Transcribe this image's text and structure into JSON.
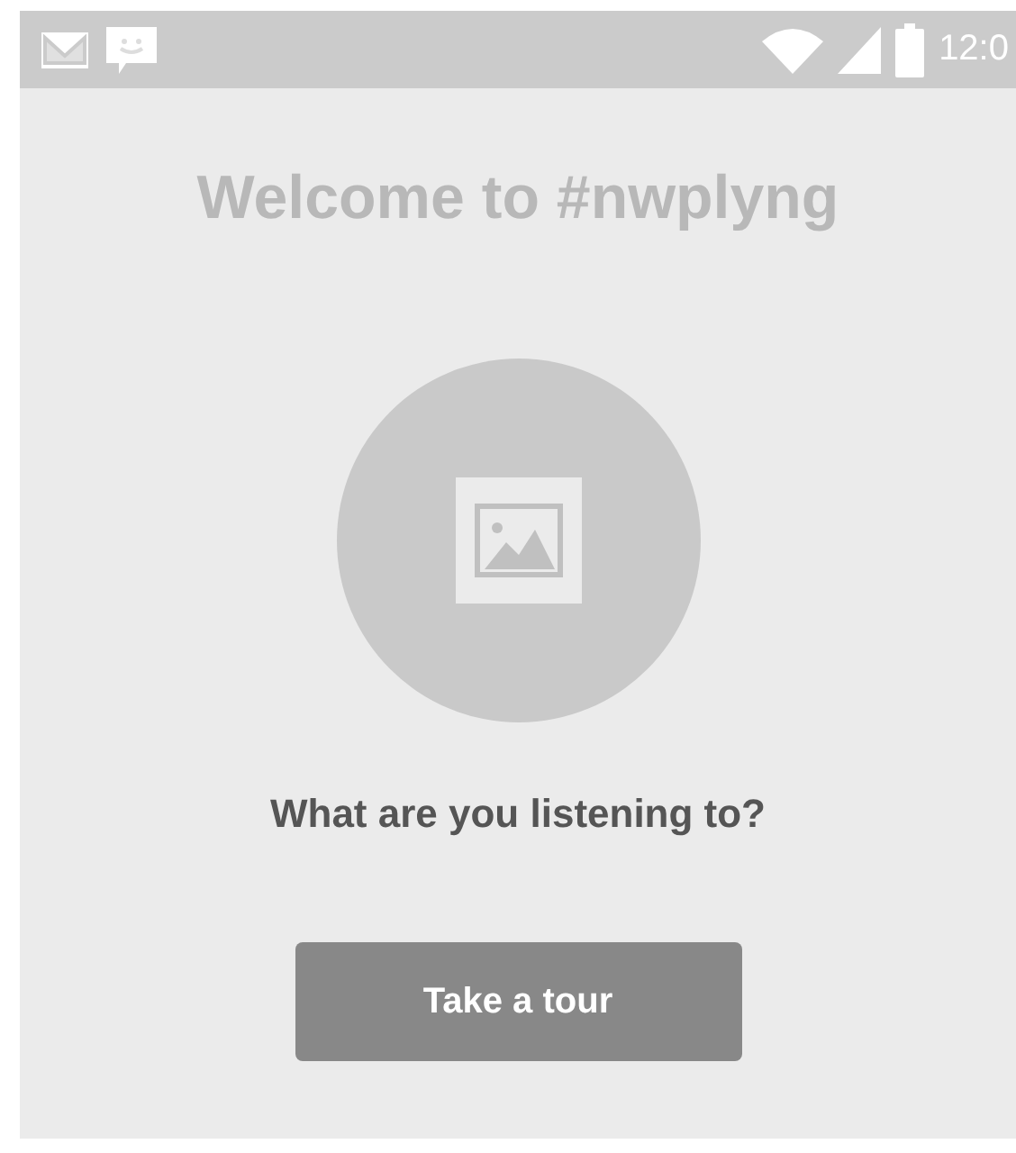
{
  "status_bar": {
    "time": "12:0"
  },
  "title": "Welcome to #nwplyng",
  "question": "What are you listening to?",
  "button": {
    "label": "Take a tour"
  }
}
